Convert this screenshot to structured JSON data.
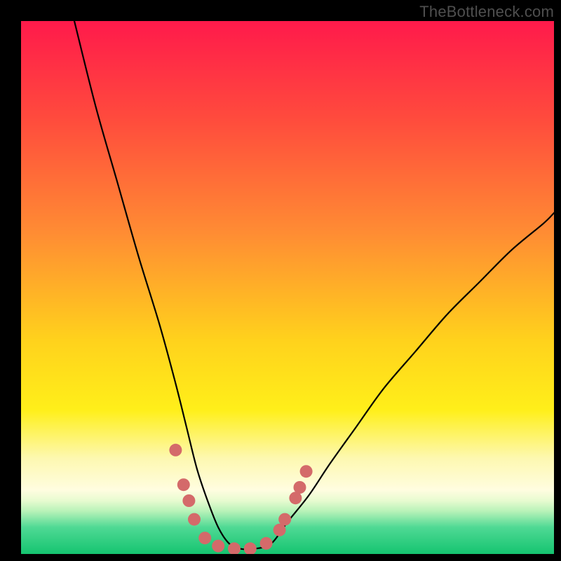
{
  "watermark": "TheBottleneck.com",
  "chart_data": {
    "type": "line",
    "title": "",
    "xlabel": "",
    "ylabel": "",
    "xlim": [
      0,
      100
    ],
    "ylim": [
      0,
      100
    ],
    "gradient_stops": [
      {
        "offset": 0.0,
        "color": "#ff1a4b"
      },
      {
        "offset": 0.18,
        "color": "#ff4a3d"
      },
      {
        "offset": 0.4,
        "color": "#ff8d33"
      },
      {
        "offset": 0.6,
        "color": "#ffd21c"
      },
      {
        "offset": 0.73,
        "color": "#ffef1a"
      },
      {
        "offset": 0.82,
        "color": "#fdf8b0"
      },
      {
        "offset": 0.88,
        "color": "#fffde0"
      },
      {
        "offset": 0.9,
        "color": "#e7fbd0"
      },
      {
        "offset": 0.92,
        "color": "#b7f2b8"
      },
      {
        "offset": 0.95,
        "color": "#4fd994"
      },
      {
        "offset": 1.0,
        "color": "#15c470"
      }
    ],
    "series": [
      {
        "name": "bottleneck-curve",
        "x": [
          10,
          14,
          18,
          22,
          26,
          29,
          31,
          33,
          35,
          37,
          39,
          41,
          44,
          47,
          50,
          54,
          58,
          63,
          68,
          74,
          80,
          86,
          92,
          98,
          100
        ],
        "values": [
          100,
          84,
          70,
          56,
          43,
          32,
          24,
          16,
          10,
          5,
          2,
          1,
          1,
          2,
          6,
          11,
          17,
          24,
          31,
          38,
          45,
          51,
          57,
          62,
          64
        ]
      }
    ],
    "markers": {
      "name": "highlighted-points",
      "color": "#d46a6a",
      "radius": 9,
      "points": [
        {
          "x": 29.0,
          "y": 19.5
        },
        {
          "x": 30.5,
          "y": 13.0
        },
        {
          "x": 31.5,
          "y": 10.0
        },
        {
          "x": 32.5,
          "y": 6.5
        },
        {
          "x": 34.5,
          "y": 3.0
        },
        {
          "x": 37.0,
          "y": 1.5
        },
        {
          "x": 40.0,
          "y": 1.0
        },
        {
          "x": 43.0,
          "y": 1.0
        },
        {
          "x": 46.0,
          "y": 2.0
        },
        {
          "x": 48.5,
          "y": 4.5
        },
        {
          "x": 49.5,
          "y": 6.5
        },
        {
          "x": 51.5,
          "y": 10.5
        },
        {
          "x": 52.3,
          "y": 12.5
        },
        {
          "x": 53.5,
          "y": 15.5
        }
      ]
    }
  }
}
